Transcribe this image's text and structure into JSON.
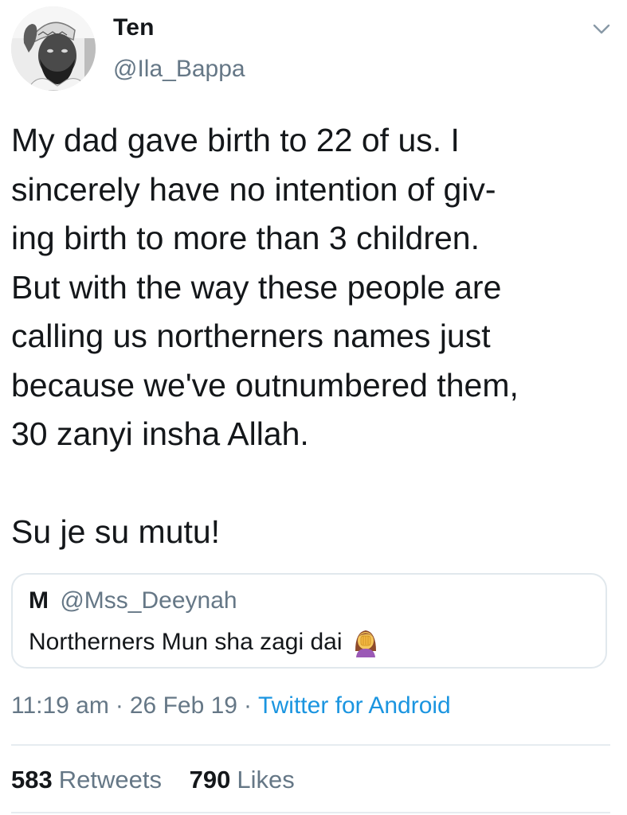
{
  "tweet": {
    "author": {
      "name": "Ten",
      "handle": "@Ila_Bappa",
      "avatar_icon": "profile-photo"
    },
    "menu_icon": "chevron-down-icon",
    "paragraphs": [
      "My dad gave birth to 22 of us. I\nsincerely have no intention of giv-\ning birth to more than 3 children.\nBut with the way these people are\ncalling us northerners names just\nbecause we've outnumbered them,\n30 zanyi insha Allah.",
      "Su je su mutu!"
    ],
    "quoted": {
      "name": "M",
      "handle": "@Mss_Deeynah",
      "text": "Northerners Mun sha zagi dai",
      "emoji_icon": "facepalm-emoji"
    },
    "meta": {
      "time": "11:19 am",
      "date": "26 Feb 19",
      "separator": "·",
      "source": "Twitter for Android"
    },
    "stats": {
      "retweets_count": "583",
      "retweets_label": "Retweets",
      "likes_count": "790",
      "likes_label": "Likes"
    },
    "colors": {
      "text": "#14171a",
      "secondary": "#657786",
      "link": "#1b95e0",
      "border": "#e1e8ed"
    }
  }
}
